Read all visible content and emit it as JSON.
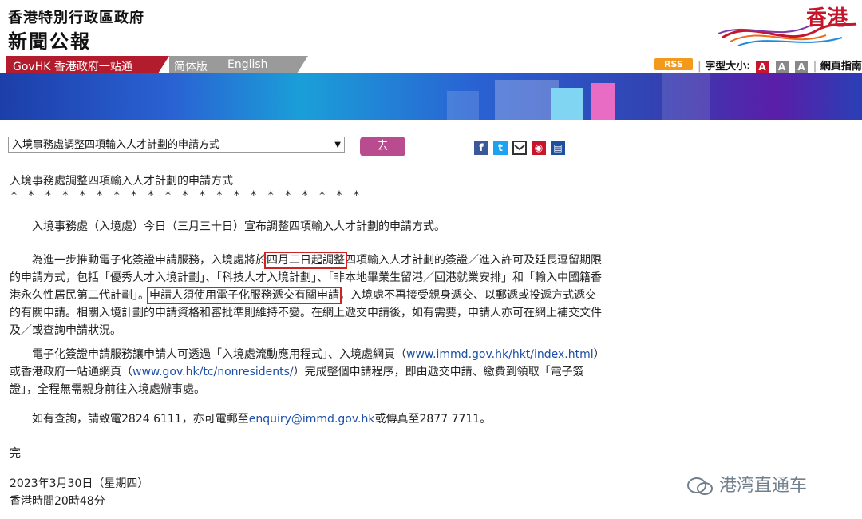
{
  "header": {
    "title_line1": "香港特別行政區政府",
    "title_line2": "新聞公報",
    "logo_text": "香港"
  },
  "nav": {
    "govhk": "GovHK 香港政府一站通",
    "simplified": "简体版",
    "english": "English",
    "rss": "RSS",
    "font_size_label": "字型大小:",
    "font_btns": [
      "A",
      "A",
      "A"
    ],
    "guide": "網頁指南",
    "colors": {
      "red": "#b21c2c",
      "gray": "#9a9a9a"
    }
  },
  "toolbar": {
    "select_value": "入境事務處調整四項輸入人才計劃的申請方式",
    "go_label": "去",
    "share_icons": [
      "facebook-icon",
      "twitter-icon",
      "email-icon",
      "pin-icon",
      "print-icon"
    ]
  },
  "article": {
    "title": "入境事務處調整四項輸入人才計劃的申請方式",
    "stars": "* * * * * * * * * * * * * * * * * * * * *",
    "p1": "入境事務處（入境處）今日（三月三十日）宣布調整四項輸入人才計劃的申請方式。",
    "p2_a": "為進一步推動電子化簽證申請服務，入境處將於",
    "p2_box1": "四月二日起調整",
    "p2_b": "四項輸入人才計劃的簽證／進入許可及延長逗留期限的申請方式，包括「優秀人才入境計劃」、「科技人才入境計劃」、「非本地畢業生留港／回港就業安排」和「輸入中國籍香港永久性居民第二代計劃」。",
    "p2_box2": "申請人須使用電子化服務遞交有關申請",
    "p2_c": "，入境處不再接受親身遞交、以郵遞或投遞方式遞交的有關申請。相關入境計劃的申請資格和審批準則維持不變。在網上遞交申請後，如有需要，申請人亦可在網上補交文件及／或查詢申請狀況。",
    "p3_a": "電子化簽證申請服務讓申請人可透過「入境處流動應用程式」、入境處網頁（",
    "p3_link1": "www.immd.gov.hk/hkt/index.html",
    "p3_b": "）或香港政府一站通網頁（",
    "p3_link2": "www.gov.hk/tc/nonresidents/",
    "p3_c": "）完成整個申請程序，即由遞交申請、繳費到領取「電子簽證」，全程無需親身前往入境處辦事處。",
    "p4_a": "如有查詢，請致電2824 6111，亦可電郵至",
    "p4_email": "enquiry@immd.gov.hk",
    "p4_b": "或傳真至2877 7711。",
    "end": "完",
    "date": "2023年3月30日（星期四）",
    "time": "香港時間20時48分"
  },
  "watermark": {
    "text": "港湾直通车"
  }
}
